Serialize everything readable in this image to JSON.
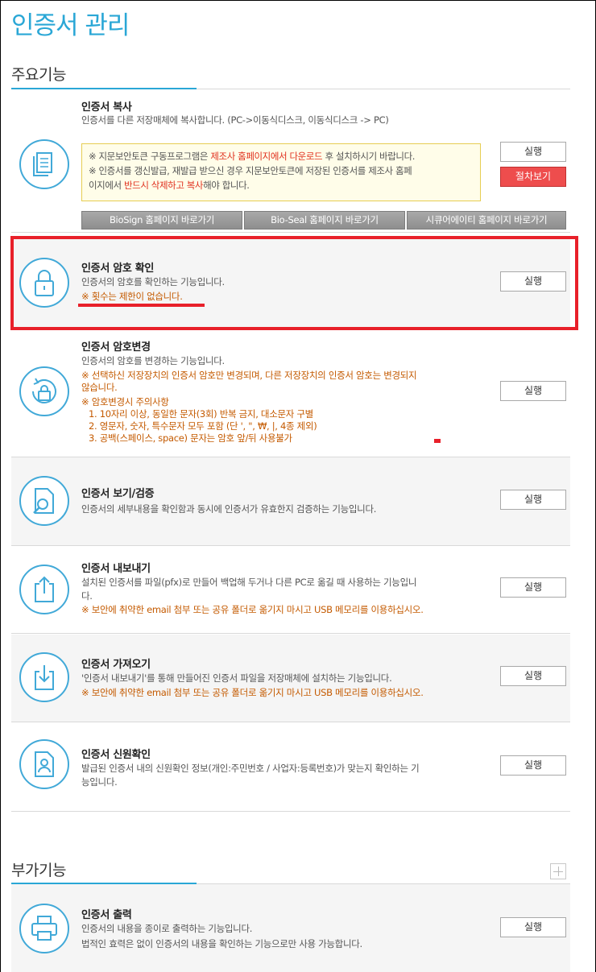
{
  "page": {
    "title": "인증서 관리"
  },
  "sections": {
    "main": "주요기능",
    "extra": "부가기능"
  },
  "copy": {
    "title": "인증서 복사",
    "desc": "인증서를 다른 저장매체에 복사합니다. (PC->이동식디스크, 이동식디스크 -> PC)",
    "notice_line1_a": "※ 지문보안토큰 구동프로그램은 ",
    "notice_line1_hl": "제조사 홈페이지에서 다운로드",
    "notice_line1_b": " 후 설치하시기 바랍니다.",
    "notice_line2": "※ 인증서를 갱신발급, 재발급 받으신 경우 지문보안토큰에 저장된 인증서를 제조사 홈페",
    "notice_line3_a": "이지에서 ",
    "notice_line3_hl": "반드시 삭제하고 복사",
    "notice_line3_b": "해야 합니다.",
    "run": "실행",
    "procedure": "절차보기",
    "links": [
      "BioSign 홈페이지 바로가기",
      "Bio-Seal 홈페이지 바로가기",
      "시큐어에이티 홈페이지 바로가기"
    ]
  },
  "pwcheck": {
    "title": "인증서 암호 확인",
    "desc": "인증서의 암호를 확인하는 기능입니다.",
    "warn": "※ 횟수는 제한이 없습니다.",
    "run": "실행"
  },
  "pwchange": {
    "title": "인증서 암호변경",
    "desc": "인증서의 암호를 변경하는 기능입니다.",
    "warn1": "※ 선택하신 저장장치의 인증서 암호만 변경되며, 다른 저장장치의 인증서 암호는 변경되지",
    "warn2": "않습니다.",
    "warn3": "※ 암호변경시 주의사항",
    "rule1": "1. 10자리 이상, 동일한 문자(3회) 반복 금지, 대소문자 구별",
    "rule2": "2. 영문자, 숫자, 특수문자 모두 포함 (단 ', \", ₩, |, 4종 제외)",
    "rule3": "3. 공백(스페이스, space) 문자는 암호 앞/뒤 사용불가",
    "run": "실행"
  },
  "view": {
    "title": "인증서 보기/검증",
    "desc": "인증서의 세부내용을 확인함과 동시에 인증서가 유효한지 검증하는 기능입니다.",
    "run": "실행"
  },
  "export": {
    "title": "인증서 내보내기",
    "desc": "설치된 인증서를 파일(pfx)로 만들어 백업해 두거나 다른 PC로 옮길 때 사용하는 기능입니",
    "desc2": "다.",
    "warn": "※ 보안에 취약한 email 첨부 또는 공유 폴더로 옮기지 마시고 USB 메모리를 이용하십시오.",
    "run": "실행"
  },
  "import": {
    "title": "인증서 가져오기",
    "desc": "'인증서 내보내기'를 통해 만들어진 인증서 파일을 저장매체에 설치하는 기능입니다.",
    "warn": "※ 보안에 취약한 email 첨부 또는 공유 폴더로 옮기지 마시고 USB 메모리를 이용하십시오.",
    "run": "실행"
  },
  "identity": {
    "title": "인증서 신원확인",
    "desc": "발급된 인증서 내의 신원확인 정보(개인:주민번호 / 사업자:등록번호)가 맞는지 확인하는 기",
    "desc2": "능입니다.",
    "run": "실행"
  },
  "print": {
    "title": "인증서 출력",
    "desc": "인증서의 내용을 종이로 출력하는 기능입니다.",
    "desc2": "법적인 효력은 없이 인증서의 내용을 확인하는 기능으로만 사용 가능합니다.",
    "run": "실행"
  },
  "colors": {
    "accent": "#2aa7d6",
    "highlight": "#e8202a",
    "warn": "#c45a00"
  }
}
